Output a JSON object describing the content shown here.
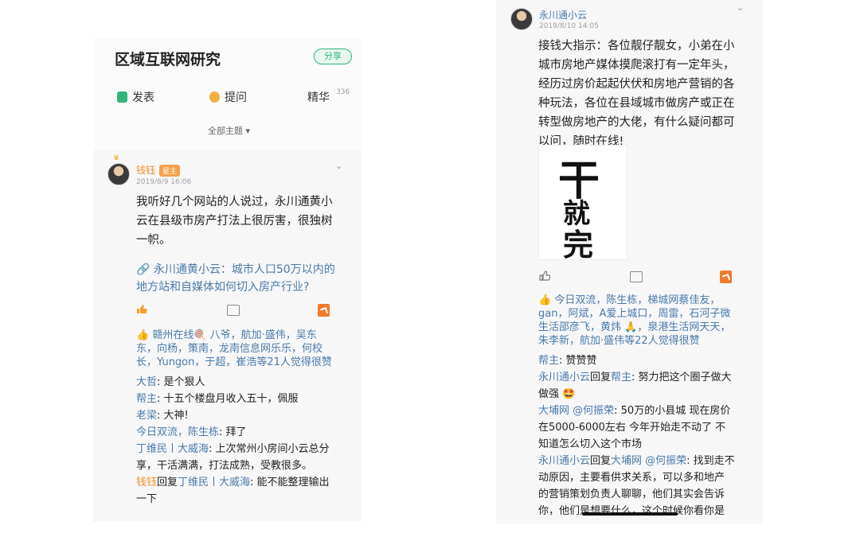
{
  "left_screen": {
    "group": {
      "title": "区域互联网研究",
      "share_label": "分享",
      "actions": [
        {
          "label": "发表",
          "icon": "post-pen-icon"
        },
        {
          "label": "提问",
          "icon": "lightbulb-icon"
        },
        {
          "label": "精华",
          "count": "336"
        }
      ],
      "filter_label": "全部主题 ▾"
    },
    "post": {
      "author": "钱钰",
      "role_badge": "星主",
      "time": "2019/8/9 16:06",
      "text_lines": [
        "我听好几个网站的人说过，永川通黄小",
        "云在县级市房产打法上很厉害，很独树",
        "一帜。"
      ],
      "link_lines": [
        "🔗 永川通黄小云：城市人口50万以内的",
        "地方站和自媒体如何切入房产行业?"
      ],
      "likes_lines": [
        "👍 赣州在线🍭 八爷，航加·盛伟，吴东",
        "东，向杨，策南，龙南信息网乐乐，何校",
        "长，Yungon，于超，崔浩等21人觉得很赞"
      ],
      "comments": [
        {
          "name": "大哲",
          "text": ": 是个狠人"
        },
        {
          "name": "帮主",
          "text": ": 十五个楼盘月收入五十，佩服"
        },
        {
          "name": "老梁",
          "text": ": 大神!"
        },
        {
          "name": "今日双流，陈生栋",
          "text": ": 拜了"
        },
        {
          "name": "丁维民丨大威海",
          "text": ": 上次常州小房间小云总分"
        },
        {
          "name": "",
          "text": "享，干活满满，打法成熟，受教很多。"
        },
        {
          "name": "钱钰",
          "reply": "回复",
          "target": "丁维民丨大威海",
          "text": ": 能不能整理输出"
        },
        {
          "name": "",
          "text": "一下"
        }
      ]
    }
  },
  "right_screen": {
    "post": {
      "author": "永川通小云",
      "time": "2019/8/10 14:05",
      "text_lines": [
        "接钱大指示：各位靓仔靓女，小弟在小",
        "城市房地产媒体摸爬滚打有一定年头，",
        "经历过房价起起伏伏和房地产营销的各",
        "种玩法，各位在县域城市做房产或正在",
        "转型做房地产的大佬，有什么疑问都可",
        "以问，随时在线!"
      ],
      "calligraphy": [
        "干",
        "就",
        "完"
      ],
      "likes_lines": [
        "👍 今日双流，陈生栋，梯城网蔡佳友，",
        "gan，阿斌，A爱上城口，周雷，石河子微",
        "生活邵彦飞，黄炜 🙏，泉港生活网天天，",
        "朱李新，航加·盛伟等22人觉得很赞"
      ],
      "comments": [
        {
          "name": "帮主",
          "text": ": 赞赞赞"
        },
        {
          "name": "永川通小云",
          "reply": "回复",
          "target": "帮主",
          "text": ": 努力把这个圈子做大"
        },
        {
          "name": "",
          "text": "做强 🤩"
        },
        {
          "name": "大埔网 @何振荣",
          "text": ": 50万的小县城 现在房价"
        },
        {
          "name": "",
          "text": "在5000-6000左右 今年开始走不动了 不"
        },
        {
          "name": "",
          "text": "知道怎么切入这个市场"
        },
        {
          "name": "永川通小云",
          "reply": "回复",
          "target": "大埔网 @何振荣",
          "text": ": 找到走不"
        },
        {
          "name": "",
          "text": "动原因，主要看供求关系，可以多和地产"
        },
        {
          "name": "",
          "text": "的营销策划负责人聊聊，他们其实会告诉"
        },
        {
          "name": "",
          "text": "你，他们是想要什么，这个时候你看你是"
        }
      ]
    }
  },
  "colors": {
    "accent_green": "#2fb57a",
    "link_blue": "#4a7aa8",
    "owner_orange": "#e8922c"
  }
}
